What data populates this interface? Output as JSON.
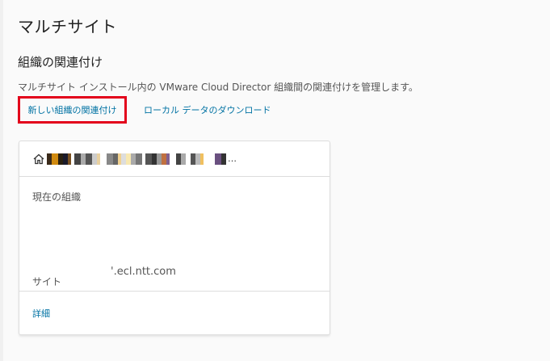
{
  "page": {
    "title": "マルチサイト"
  },
  "section": {
    "title": "組織の関連付け",
    "description": "マルチサイト インストール内の VMware Cloud Director 組織間の関連付けを管理します。"
  },
  "actions": {
    "new_association": "新しい組織の関連付け",
    "download_local_data": "ローカル データのダウンロード"
  },
  "card": {
    "header_icon": "home-icon",
    "header_ellipsis": "…",
    "current_org_label": "現在の組織",
    "site_label": "サイト",
    "site_value": "'.ecl.ntt.com",
    "details_link": "詳細"
  },
  "colors": {
    "link": "#0072a3",
    "highlight_border": "#e3001b"
  }
}
